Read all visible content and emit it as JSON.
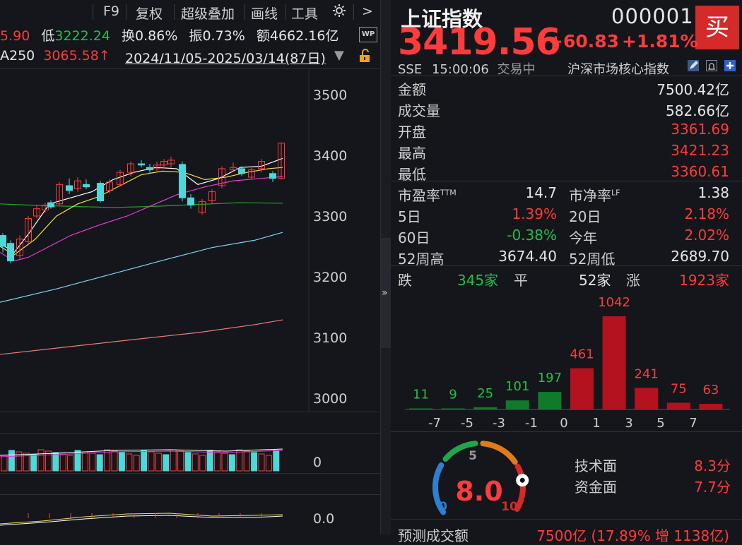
{
  "toolbar": {
    "f9": "F9",
    "restore": "复权",
    "overlay": "超级叠加",
    "draw": "画线",
    "tools": "工具",
    "more": ">"
  },
  "quote_row": {
    "high_fragment": "5.90",
    "low_label": "低",
    "low_value": "3222.24",
    "turnover_label": "换",
    "turnover_value": "0.86%",
    "amplitude_label": "振",
    "amplitude_value": "0.73%",
    "amount_label": "额",
    "amount_value": "4662.16亿",
    "wp": "WP"
  },
  "ma_row": {
    "ma_label": "A250",
    "ma_value": "3065.58↑",
    "range": "2024/11/05-2025/03/14(87日)",
    "dropdown": "▼"
  },
  "price_axis": [
    "3500",
    "3400",
    "3300",
    "3200",
    "3100",
    "3000"
  ],
  "volume_axis": "0",
  "indicator_axis": "0.0",
  "colors": {
    "up": "#ff3b3b",
    "down": "#1fc24a",
    "flat_bar": "#4dd9d9",
    "buy_bg": "#d42a2a",
    "ma5": "#ffffff",
    "ma10": "#f5e04a",
    "ma20": "#e83bd6",
    "ma60": "#1fa61f",
    "ma120": "#7ad6f0",
    "ma250": "#f07a7a"
  },
  "header": {
    "name": "上证指数",
    "code": "000001",
    "buy_label": "买",
    "price": "3419.56",
    "change": "+60.83",
    "change_pct": "+1.81%",
    "exchange": "SSE",
    "time": "15:00:06",
    "status": "交易中",
    "category": "沪深市场核心指数"
  },
  "stats": [
    {
      "label": "金额",
      "value": "7500.42亿",
      "color": "white"
    },
    {
      "label": "成交量",
      "value": "582.66亿",
      "color": "white"
    },
    {
      "label": "开盘",
      "value": "3361.69",
      "color": "red"
    },
    {
      "label": "最高",
      "value": "3421.23",
      "color": "red"
    },
    {
      "label": "最低",
      "value": "3360.61",
      "color": "red"
    }
  ],
  "ratios": {
    "pe_label": "市盈率",
    "pe_sup": "TTM",
    "pe_value": "14.7",
    "pb_label": "市净率",
    "pb_sup": "LF",
    "pb_value": "1.38",
    "d5_label": "5日",
    "d5_value": "1.39%",
    "d20_label": "20日",
    "d20_value": "2.18%",
    "d60_label": "60日",
    "d60_value": "-0.38%",
    "ytd_label": "今年",
    "ytd_value": "2.02%",
    "w52h_label": "52周高",
    "w52h_value": "3674.40",
    "w52l_label": "52周低",
    "w52l_value": "2689.70"
  },
  "breadth": {
    "down_label": "跌",
    "down_value": "345家",
    "flat_label": "平",
    "flat_value": "52家",
    "up_label": "涨",
    "up_value": "1923家"
  },
  "chart_data": {
    "type": "bar",
    "categories": [
      "-7",
      "-5",
      "-3",
      "-1",
      "1",
      "3",
      "5",
      "7"
    ],
    "x_ticks": [
      "-7",
      "-5",
      "-3",
      "-1",
      "0",
      "1",
      "3",
      "5",
      "7"
    ],
    "values": [
      11,
      9,
      25,
      101,
      197,
      461,
      1042,
      241,
      75,
      63
    ],
    "bins": [
      "≤-7",
      "-7~-5",
      "-5~-3",
      "-3~-1",
      "-1~0",
      "0~1",
      "1~3",
      "3~5",
      "5~7",
      "≥7"
    ],
    "bar_colors": [
      "green",
      "green",
      "green",
      "green",
      "green",
      "red",
      "red",
      "red",
      "red",
      "red"
    ]
  },
  "gauge": {
    "score": "8.0",
    "min": "0",
    "mid": "5",
    "max": "10",
    "value": 8.0
  },
  "scores": {
    "tech_label": "技术面",
    "tech_value": "8.3分",
    "fund_label": "资金面",
    "fund_value": "7.7分"
  },
  "forecast": {
    "label": "预测成交额",
    "value": "7500亿 (17.89% 增 1138亿)"
  }
}
